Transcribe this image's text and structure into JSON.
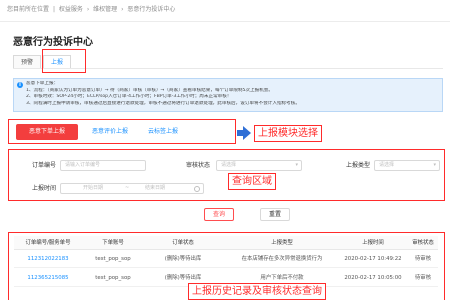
{
  "breadcrumb": {
    "prefix": "您目前所在位置",
    "items": [
      "权益服务",
      "维权管理",
      "恶意行为投诉中心"
    ]
  },
  "page_title": "恶意行为投诉中心",
  "tabs": [
    {
      "label": "预警"
    },
    {
      "label": "上报"
    }
  ],
  "notice": {
    "lines": [
      "恶意下单上报：",
      "1、流程：（商家认为订单为恶意订单）→ 待（商家）审核（审核）→（商家）查看审核结果，每个订单限制5次上报机会。",
      "2、审核时效：SOP-24小时；ECLP/sop入仓订单-4工作小时；FBP订单-3工作小时；周末正常审核！",
      "3、同程满时上报申请审核，审核通过后直接进行退款处理，审核不通过将进行订单退款处理，此审核后，设订单将不会计入指标考核。"
    ]
  },
  "actions": {
    "report_button": "恶意下单上报",
    "link_eval": "恶意评价上报",
    "link_cloud": "云标签上报"
  },
  "annotations": {
    "module": "上报模块选择",
    "query": "查询区域",
    "history": "上报历史记录及审核状态查询"
  },
  "filters": {
    "order_no": {
      "label": "订单编号",
      "placeholder": "请输入订单编号"
    },
    "audit_status": {
      "label": "审核状态",
      "placeholder": "请选择"
    },
    "report_type": {
      "label": "上报类型",
      "placeholder": "请选择"
    },
    "report_time": {
      "label": "上报时间",
      "start_placeholder": "开始日期",
      "end_placeholder": "结束日期",
      "separator": "~"
    }
  },
  "buttons": {
    "query": "查询",
    "reset": "重置"
  },
  "table": {
    "headers": [
      "订单编号/服务单号",
      "下单账号",
      "订单状态",
      "上报类型",
      "上报时间",
      "审核状态"
    ],
    "rows": [
      [
        "112312022183",
        "test_pop_sop",
        "(删除)等待出库",
        "在本店铺存在多次异常退换货行为",
        "2020-02-17 10:49:22",
        "待审核"
      ],
      [
        "112365215085",
        "test_pop_sop",
        "(删除)等待出库",
        "用户下单后不付款",
        "2020-02-17 10:05:00",
        "待审核"
      ]
    ]
  },
  "colors": {
    "accent": "#1890ff",
    "report_button": "#f33e3e",
    "annotation": "#ff2b2b",
    "arrow": "#2f6fd6"
  }
}
